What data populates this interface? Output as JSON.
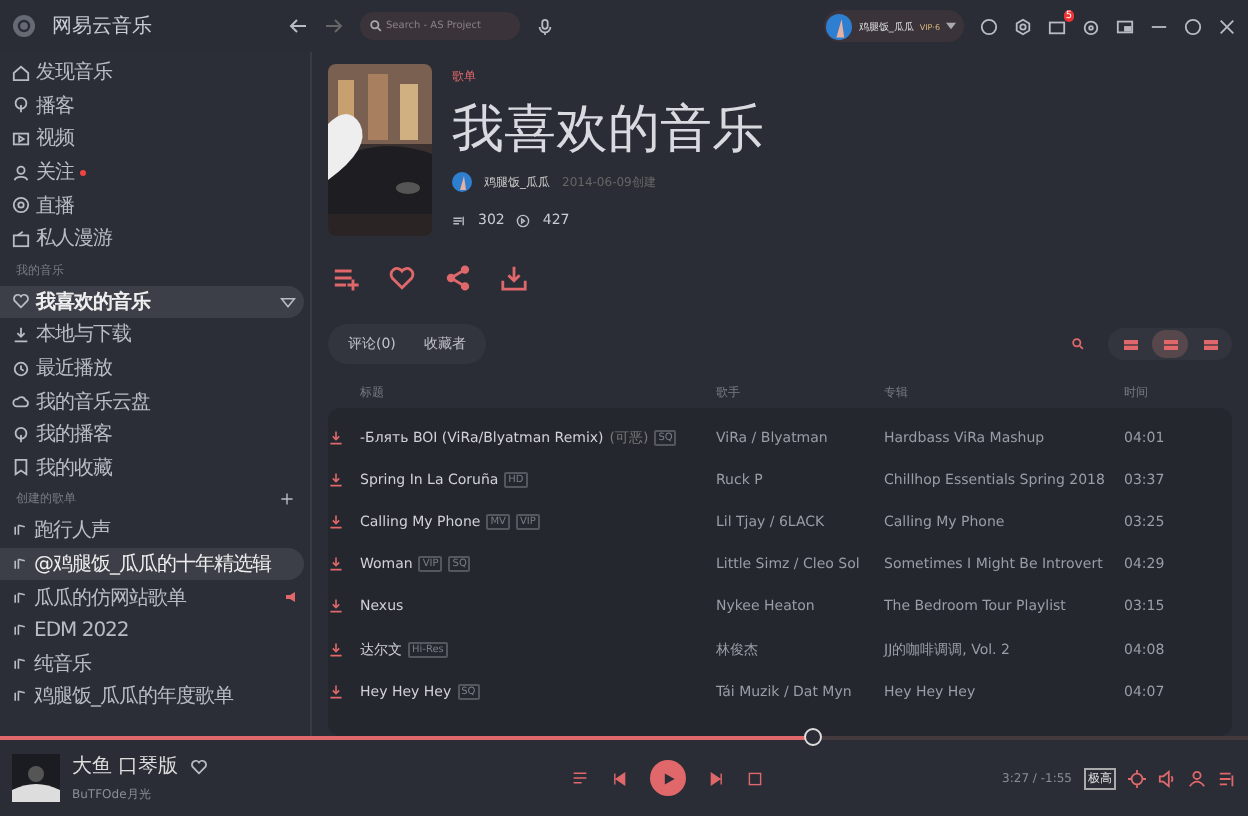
{
  "app": {
    "name": "网易云音乐"
  },
  "search": {
    "placeholder": "Search - AS Project"
  },
  "user": {
    "name": "鸡腿饭_瓜瓜",
    "vip": "VIP·6",
    "mail_badge": "5"
  },
  "sidebar": {
    "items": [
      {
        "label": "发现音乐",
        "dot": false,
        "selected": false
      },
      {
        "label": "播客",
        "dot": false,
        "selected": false
      },
      {
        "label": "视频",
        "dot": false,
        "selected": false
      },
      {
        "label": "关注",
        "dot": true,
        "selected": false
      },
      {
        "label": "直播",
        "dot": false,
        "selected": false
      },
      {
        "label": "私人漫游",
        "dot": false,
        "selected": false
      }
    ],
    "my_music_title": "我的音乐",
    "my_music": [
      {
        "label": "我喜欢的音乐",
        "selected": true
      },
      {
        "label": "本地与下载",
        "selected": false
      },
      {
        "label": "最近播放",
        "selected": false
      },
      {
        "label": "我的音乐云盘",
        "selected": false
      },
      {
        "label": "我的播客",
        "selected": false
      },
      {
        "label": "我的收藏",
        "selected": false
      }
    ],
    "playlists_title": "创建的歌单",
    "playlists": [
      {
        "label": "跑行人声",
        "selected": false,
        "playing": false
      },
      {
        "label": "@鸡腿饭_瓜瓜的十年精选辑",
        "selected": true,
        "playing": false
      },
      {
        "label": "瓜瓜的仿网站歌单",
        "selected": false,
        "playing": true
      },
      {
        "label": "EDM 2022",
        "selected": false,
        "playing": false
      },
      {
        "label": "纯音乐",
        "selected": false,
        "playing": false
      },
      {
        "label": "鸡腿饭_瓜瓜的年度歌单",
        "selected": false,
        "playing": false
      }
    ]
  },
  "header": {
    "tag": "歌单",
    "title": "我喜欢的音乐",
    "creator": "鸡腿饭_瓜瓜",
    "created": "2014-06-09创建",
    "tracks": "302",
    "plays": "427"
  },
  "tabs": [
    {
      "label": "评论(0)",
      "selected": false
    },
    {
      "label": "收藏者",
      "selected": false
    }
  ],
  "view_modes": [
    {
      "selected": false
    },
    {
      "selected": true
    },
    {
      "selected": false
    }
  ],
  "table": {
    "columns": [
      "标题",
      "歌手",
      "专辑",
      "时间"
    ],
    "rows": [
      {
        "title": "-Блять BOI  (ViRa/Blyatman Remix)",
        "alias": "(可恶)",
        "tags": [
          "SQ"
        ],
        "artist": "ViRa / Blyatman",
        "album": "Hardbass ViRa Mashup",
        "time": "04:01"
      },
      {
        "title": "Spring In La Coruña",
        "tags": [
          "HD"
        ],
        "artist": "Ruck P",
        "album": "Chillhop Essentials Spring 2018",
        "time": "03:37"
      },
      {
        "title": "Calling My Phone",
        "tags": [
          "MV",
          "VIP"
        ],
        "artist": "Lil Tjay / 6LACK",
        "album": "Calling My Phone",
        "time": "03:25"
      },
      {
        "title": "Woman",
        "tags": [
          "VIP",
          "SQ"
        ],
        "artist": "Little Simz / Cleo Sol",
        "album": "Sometimes I Might Be Introvert",
        "time": "04:29"
      },
      {
        "title": "Nexus",
        "tags": [],
        "artist": "Nykee Heaton",
        "album": "The Bedroom Tour Playlist",
        "time": "03:15"
      },
      {
        "title": "达尔文",
        "tags": [
          "Hi-Res"
        ],
        "artist": "林俊杰",
        "album": "JJ的咖啡调调, Vol. 2",
        "time": "04:08"
      },
      {
        "title": "Hey Hey Hey",
        "tags": [
          "SQ"
        ],
        "artist": "Tái Muzik / Dat Myn",
        "album": "Hey Hey Hey",
        "time": "04:07"
      }
    ]
  },
  "player": {
    "title": "大鱼 口琴版",
    "artist": "BuTFOde月光",
    "level": 0.65,
    "time": "3:27 / -1:55",
    "quality": "极高"
  }
}
